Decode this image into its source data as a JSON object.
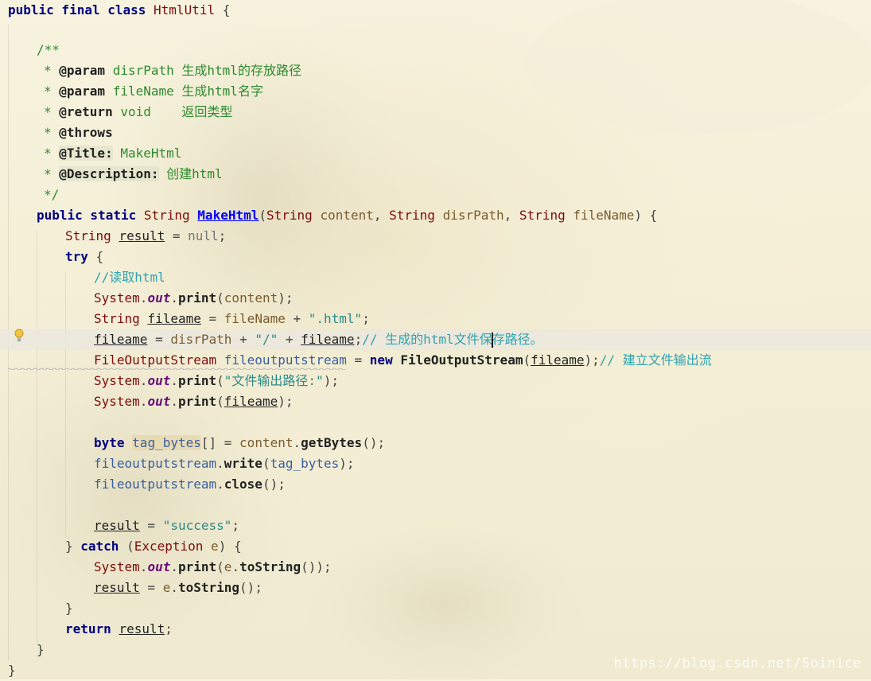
{
  "code": {
    "l0_class_decl": "HtmlUtil",
    "l2_doc_open": "/**",
    "l3_param_tag": "@param",
    "l3_param_name": "disrPath",
    "l3_param_desc": "生成html的存放路径",
    "l4_param_tag": "@param",
    "l4_param_name": "fileName",
    "l4_param_desc": "生成html名字",
    "l5_return_tag": "@return",
    "l5_return_type": "void",
    "l5_return_desc": "返回类型",
    "l6_throws_tag": "@throws",
    "l7_title_tag": "@Title:",
    "l7_title_val": "MakeHtml",
    "l8_desc_tag": "@Description:",
    "l8_desc_val": "创建html",
    "l9_doc_close": "*/",
    "method_name": "MakeHtml",
    "p1_type": "String",
    "p1_name": "content",
    "p2_type": "String",
    "p2_name": "disrPath",
    "p3_type": "String",
    "p3_name": "fileName",
    "comment_read": "//读取html",
    "str_html_ext": "\".html\"",
    "str_slash": "\"/\"",
    "comment_gen_path": "// 生成的html文件保",
    "comment_gen_path2": "存路径。",
    "fos_type": "FileOutputStream",
    "fos_var": "fileoutputstream",
    "fos_ctor": "FileOutputStream",
    "comment_build": "// 建立文件输出流",
    "str_out_path": "\"文件输出路径:\"",
    "tag_bytes": "tag_bytes",
    "str_success": "\"success\"",
    "exception_type": "Exception",
    "exception_var": "e"
  },
  "watermark": "https://blog.csdn.net/Soinice",
  "colors": {
    "background": "#f4efd6",
    "keyword": "#000080",
    "string": "#2a8b8a",
    "comment": "#2fa3b0",
    "doc_text": "#2f8a2f",
    "current_line": "#ebe8de"
  }
}
